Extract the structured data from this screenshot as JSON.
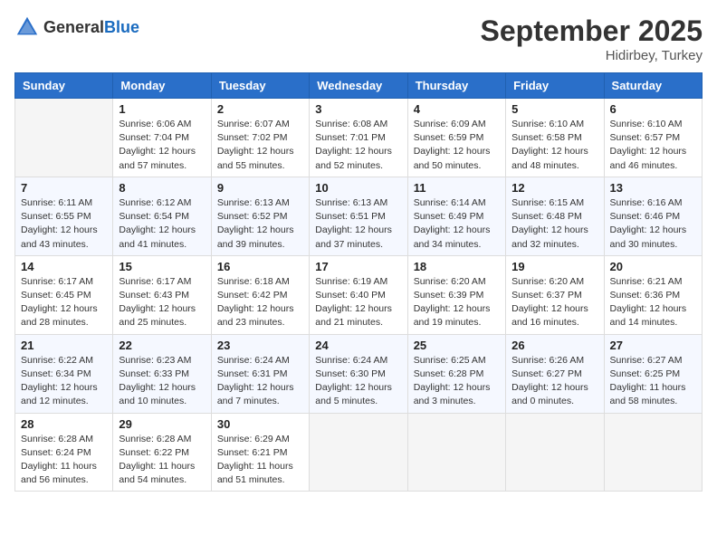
{
  "header": {
    "logo_general": "General",
    "logo_blue": "Blue",
    "month_year": "September 2025",
    "location": "Hidirbey, Turkey"
  },
  "days_of_week": [
    "Sunday",
    "Monday",
    "Tuesday",
    "Wednesday",
    "Thursday",
    "Friday",
    "Saturday"
  ],
  "weeks": [
    [
      {
        "day": "",
        "info": ""
      },
      {
        "day": "1",
        "info": "Sunrise: 6:06 AM\nSunset: 7:04 PM\nDaylight: 12 hours\nand 57 minutes."
      },
      {
        "day": "2",
        "info": "Sunrise: 6:07 AM\nSunset: 7:02 PM\nDaylight: 12 hours\nand 55 minutes."
      },
      {
        "day": "3",
        "info": "Sunrise: 6:08 AM\nSunset: 7:01 PM\nDaylight: 12 hours\nand 52 minutes."
      },
      {
        "day": "4",
        "info": "Sunrise: 6:09 AM\nSunset: 6:59 PM\nDaylight: 12 hours\nand 50 minutes."
      },
      {
        "day": "5",
        "info": "Sunrise: 6:10 AM\nSunset: 6:58 PM\nDaylight: 12 hours\nand 48 minutes."
      },
      {
        "day": "6",
        "info": "Sunrise: 6:10 AM\nSunset: 6:57 PM\nDaylight: 12 hours\nand 46 minutes."
      }
    ],
    [
      {
        "day": "7",
        "info": "Sunrise: 6:11 AM\nSunset: 6:55 PM\nDaylight: 12 hours\nand 43 minutes."
      },
      {
        "day": "8",
        "info": "Sunrise: 6:12 AM\nSunset: 6:54 PM\nDaylight: 12 hours\nand 41 minutes."
      },
      {
        "day": "9",
        "info": "Sunrise: 6:13 AM\nSunset: 6:52 PM\nDaylight: 12 hours\nand 39 minutes."
      },
      {
        "day": "10",
        "info": "Sunrise: 6:13 AM\nSunset: 6:51 PM\nDaylight: 12 hours\nand 37 minutes."
      },
      {
        "day": "11",
        "info": "Sunrise: 6:14 AM\nSunset: 6:49 PM\nDaylight: 12 hours\nand 34 minutes."
      },
      {
        "day": "12",
        "info": "Sunrise: 6:15 AM\nSunset: 6:48 PM\nDaylight: 12 hours\nand 32 minutes."
      },
      {
        "day": "13",
        "info": "Sunrise: 6:16 AM\nSunset: 6:46 PM\nDaylight: 12 hours\nand 30 minutes."
      }
    ],
    [
      {
        "day": "14",
        "info": "Sunrise: 6:17 AM\nSunset: 6:45 PM\nDaylight: 12 hours\nand 28 minutes."
      },
      {
        "day": "15",
        "info": "Sunrise: 6:17 AM\nSunset: 6:43 PM\nDaylight: 12 hours\nand 25 minutes."
      },
      {
        "day": "16",
        "info": "Sunrise: 6:18 AM\nSunset: 6:42 PM\nDaylight: 12 hours\nand 23 minutes."
      },
      {
        "day": "17",
        "info": "Sunrise: 6:19 AM\nSunset: 6:40 PM\nDaylight: 12 hours\nand 21 minutes."
      },
      {
        "day": "18",
        "info": "Sunrise: 6:20 AM\nSunset: 6:39 PM\nDaylight: 12 hours\nand 19 minutes."
      },
      {
        "day": "19",
        "info": "Sunrise: 6:20 AM\nSunset: 6:37 PM\nDaylight: 12 hours\nand 16 minutes."
      },
      {
        "day": "20",
        "info": "Sunrise: 6:21 AM\nSunset: 6:36 PM\nDaylight: 12 hours\nand 14 minutes."
      }
    ],
    [
      {
        "day": "21",
        "info": "Sunrise: 6:22 AM\nSunset: 6:34 PM\nDaylight: 12 hours\nand 12 minutes."
      },
      {
        "day": "22",
        "info": "Sunrise: 6:23 AM\nSunset: 6:33 PM\nDaylight: 12 hours\nand 10 minutes."
      },
      {
        "day": "23",
        "info": "Sunrise: 6:24 AM\nSunset: 6:31 PM\nDaylight: 12 hours\nand 7 minutes."
      },
      {
        "day": "24",
        "info": "Sunrise: 6:24 AM\nSunset: 6:30 PM\nDaylight: 12 hours\nand 5 minutes."
      },
      {
        "day": "25",
        "info": "Sunrise: 6:25 AM\nSunset: 6:28 PM\nDaylight: 12 hours\nand 3 minutes."
      },
      {
        "day": "26",
        "info": "Sunrise: 6:26 AM\nSunset: 6:27 PM\nDaylight: 12 hours\nand 0 minutes."
      },
      {
        "day": "27",
        "info": "Sunrise: 6:27 AM\nSunset: 6:25 PM\nDaylight: 11 hours\nand 58 minutes."
      }
    ],
    [
      {
        "day": "28",
        "info": "Sunrise: 6:28 AM\nSunset: 6:24 PM\nDaylight: 11 hours\nand 56 minutes."
      },
      {
        "day": "29",
        "info": "Sunrise: 6:28 AM\nSunset: 6:22 PM\nDaylight: 11 hours\nand 54 minutes."
      },
      {
        "day": "30",
        "info": "Sunrise: 6:29 AM\nSunset: 6:21 PM\nDaylight: 11 hours\nand 51 minutes."
      },
      {
        "day": "",
        "info": ""
      },
      {
        "day": "",
        "info": ""
      },
      {
        "day": "",
        "info": ""
      },
      {
        "day": "",
        "info": ""
      }
    ]
  ]
}
